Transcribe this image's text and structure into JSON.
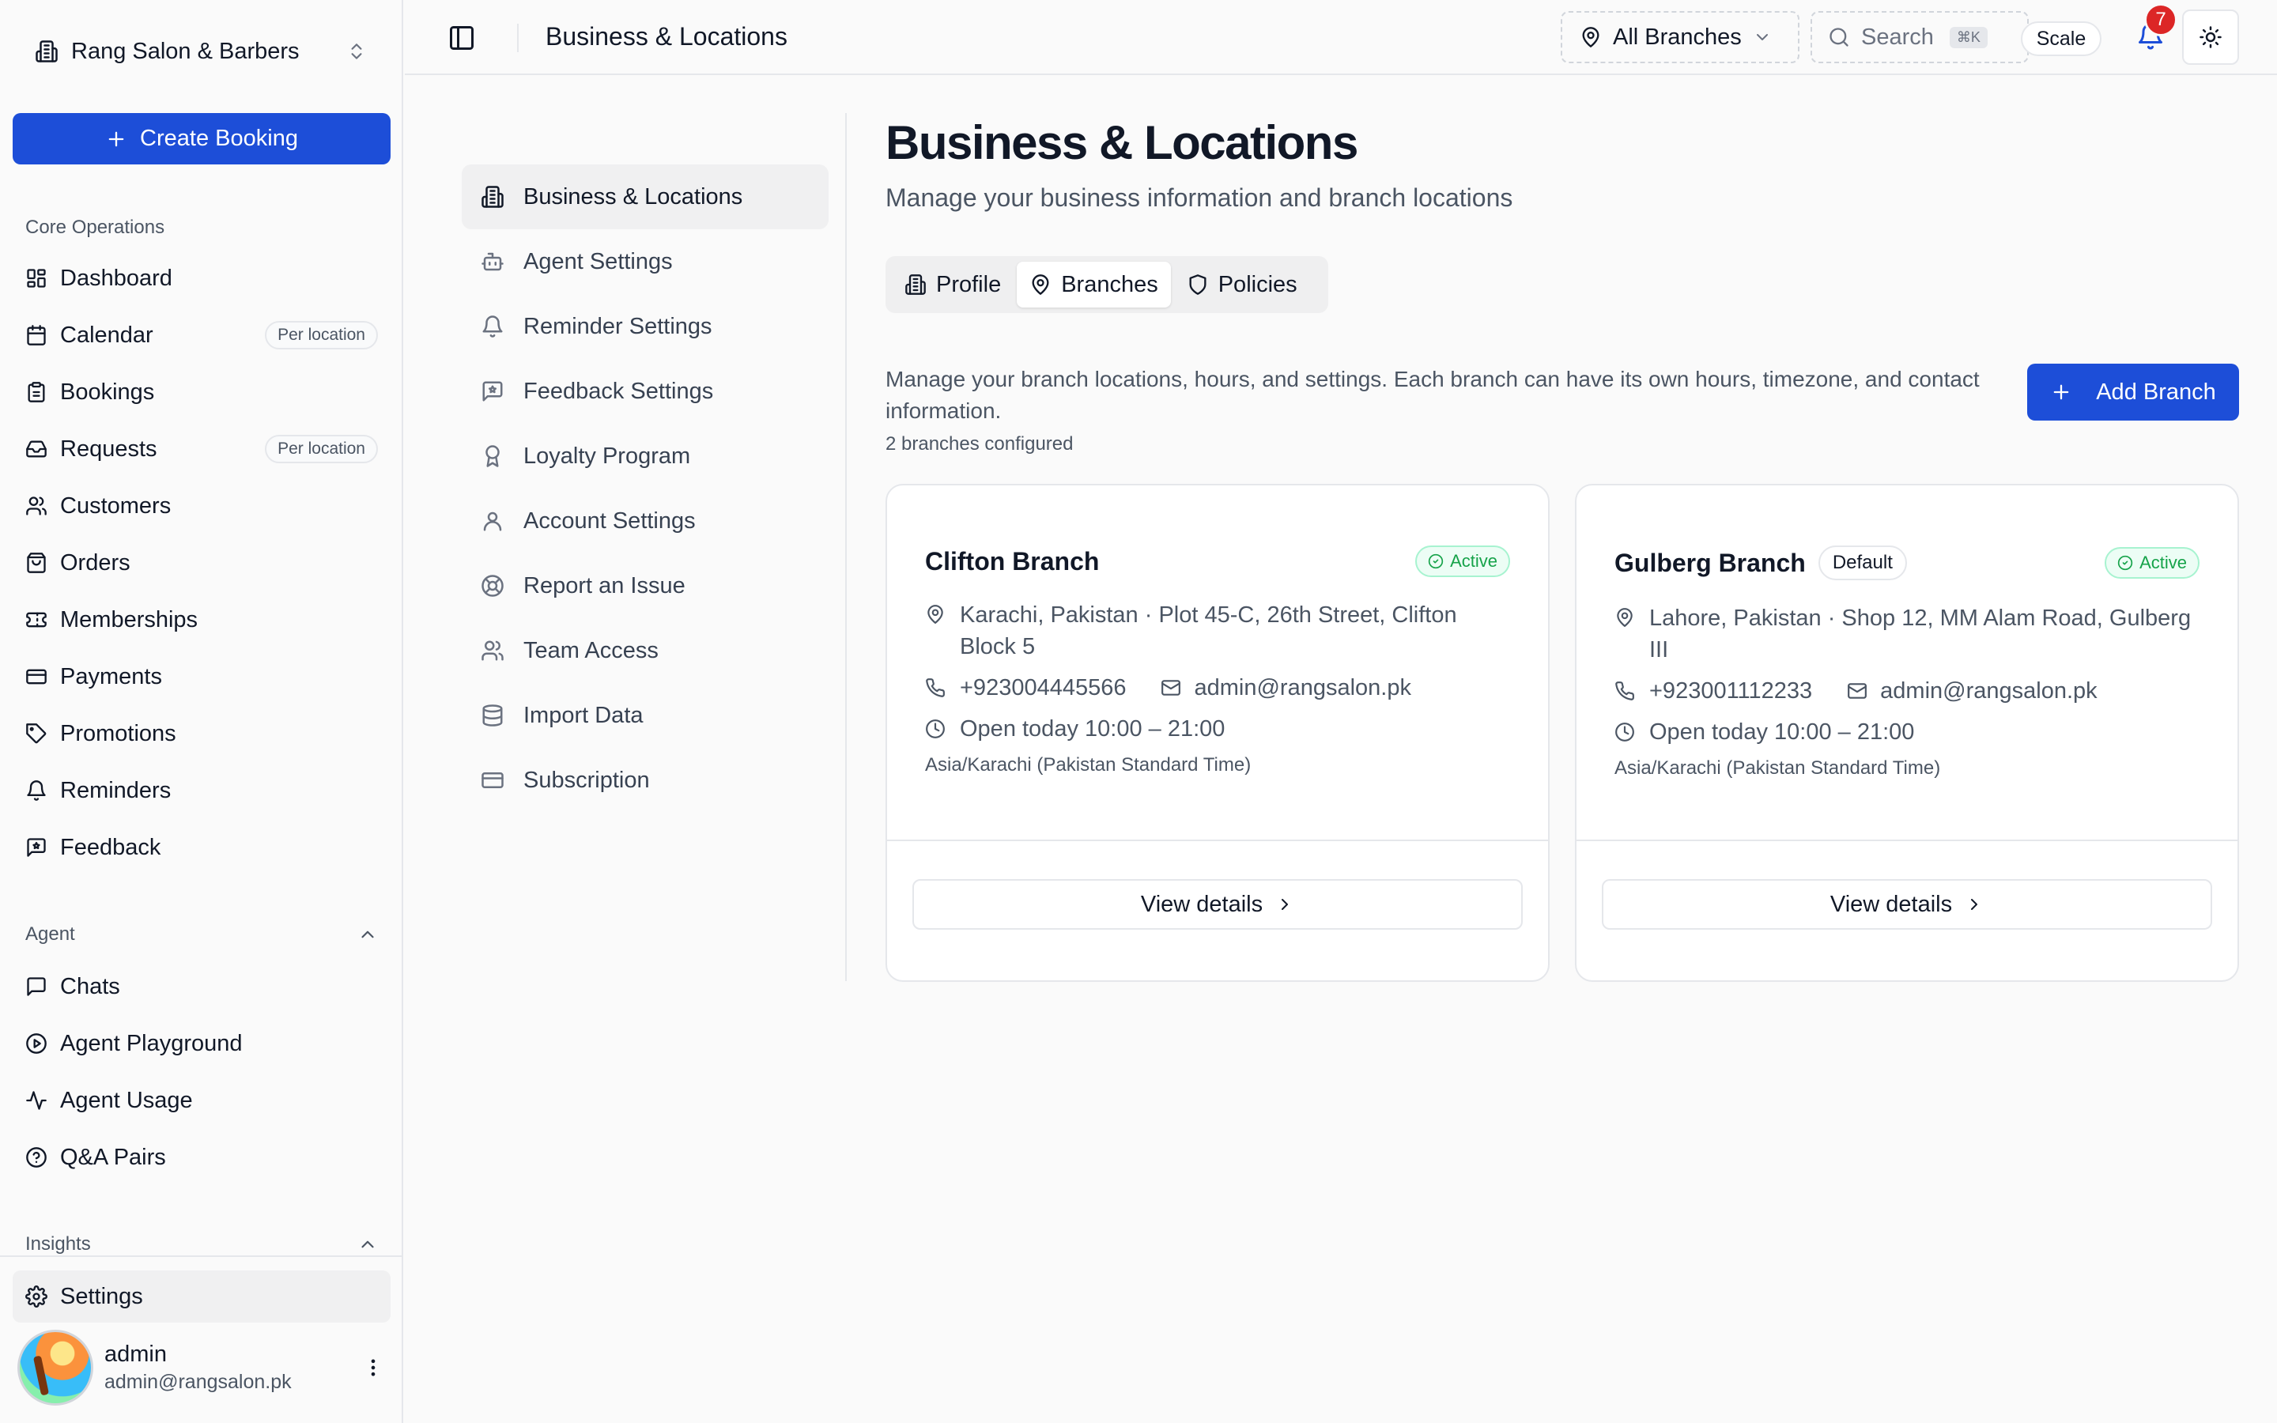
{
  "org": {
    "name": "Rang Salon & Barbers"
  },
  "sidebar": {
    "create_label": "Create Booking",
    "core_label": "Core Operations",
    "core_items": [
      {
        "label": "Dashboard"
      },
      {
        "label": "Calendar",
        "badge": "Per location"
      },
      {
        "label": "Bookings"
      },
      {
        "label": "Requests",
        "badge": "Per location"
      },
      {
        "label": "Customers"
      },
      {
        "label": "Orders"
      },
      {
        "label": "Memberships"
      },
      {
        "label": "Payments"
      },
      {
        "label": "Promotions"
      },
      {
        "label": "Reminders"
      },
      {
        "label": "Feedback"
      }
    ],
    "agent_label": "Agent",
    "agent_items": [
      {
        "label": "Chats"
      },
      {
        "label": "Agent Playground"
      },
      {
        "label": "Agent Usage"
      },
      {
        "label": "Q&A Pairs"
      }
    ],
    "insights_label": "Insights",
    "settings_label": "Settings",
    "user": {
      "name": "admin",
      "email": "admin@rangsalon.pk"
    }
  },
  "topbar": {
    "title": "Business & Locations",
    "branch_selector": "All Branches",
    "search_label": "Search",
    "search_kbd": "⌘K",
    "scale_label": "Scale",
    "notification_count": "7"
  },
  "settings_nav": [
    {
      "label": "Business & Locations",
      "icon": "building-icon"
    },
    {
      "label": "Agent Settings",
      "icon": "bot-icon"
    },
    {
      "label": "Reminder Settings",
      "icon": "bell-icon"
    },
    {
      "label": "Feedback Settings",
      "icon": "feedback-icon"
    },
    {
      "label": "Loyalty Program",
      "icon": "award-icon"
    },
    {
      "label": "Account Settings",
      "icon": "user-icon"
    },
    {
      "label": "Report an Issue",
      "icon": "lifebuoy-icon"
    },
    {
      "label": "Team Access",
      "icon": "users-icon"
    },
    {
      "label": "Import Data",
      "icon": "database-icon"
    },
    {
      "label": "Subscription",
      "icon": "card-icon"
    }
  ],
  "main": {
    "title": "Business & Locations",
    "subtitle": "Manage your business information and branch locations",
    "tabs": [
      {
        "label": "Profile"
      },
      {
        "label": "Branches"
      },
      {
        "label": "Policies"
      }
    ],
    "description": "Manage your branch locations, hours, and settings. Each branch can have its own hours, timezone, and contact information.",
    "count": "2 branches configured",
    "add_label": "Add Branch"
  },
  "branches": [
    {
      "name": "Clifton Branch",
      "status": "Active",
      "address": "Karachi, Pakistan · Plot 45-C, 26th Street, Clifton Block 5",
      "phone": "+923004445566",
      "email": "admin@rangsalon.pk",
      "hours": "Open today 10:00 – 21:00",
      "timezone": "Asia/Karachi (Pakistan Standard Time)",
      "view_label": "View details"
    },
    {
      "name": "Gulberg Branch",
      "default_label": "Default",
      "status": "Active",
      "address": "Lahore, Pakistan · Shop 12, MM Alam Road, Gulberg III",
      "phone": "+923001112233",
      "email": "admin@rangsalon.pk",
      "hours": "Open today 10:00 – 21:00",
      "timezone": "Asia/Karachi (Pakistan Standard Time)",
      "view_label": "View details"
    }
  ],
  "colors": {
    "accent": "#1d4ed8",
    "active": "#16a34a",
    "badge": "#dc2626"
  }
}
